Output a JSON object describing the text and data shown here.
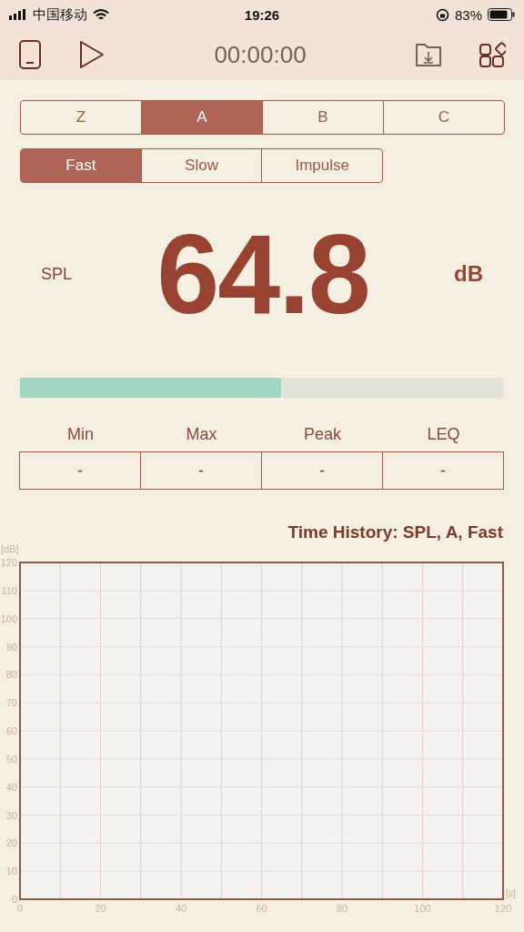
{
  "status_bar": {
    "carrier": "中国移动",
    "time": "19:26",
    "battery": "83%"
  },
  "toolbar": {
    "timer": "00:00:00"
  },
  "weighting_tabs": [
    {
      "label": "Z",
      "selected": false
    },
    {
      "label": "A",
      "selected": true
    },
    {
      "label": "B",
      "selected": false
    },
    {
      "label": "C",
      "selected": false
    }
  ],
  "response_tabs": [
    {
      "label": "Fast",
      "selected": true
    },
    {
      "label": "Slow",
      "selected": false
    },
    {
      "label": "Impulse",
      "selected": false
    }
  ],
  "reading": {
    "label": "SPL",
    "value": "64.8",
    "unit": "dB"
  },
  "meter": {
    "level": 0.54
  },
  "stats": [
    {
      "label": "Min",
      "value": "-"
    },
    {
      "label": "Max",
      "value": "-"
    },
    {
      "label": "Peak",
      "value": "-"
    },
    {
      "label": "LEQ",
      "value": "-"
    }
  ],
  "history": {
    "chart_data": {
      "type": "line",
      "title": "Time History: SPL, A, Fast",
      "ylabel": "[dB]",
      "xlabel": "[s]",
      "grid": true,
      "xlim": [
        0,
        120
      ],
      "ylim": [
        0,
        120
      ],
      "xticks": [
        0,
        20,
        40,
        60,
        80,
        100,
        120
      ],
      "yticks": [
        0,
        10,
        20,
        30,
        40,
        50,
        60,
        70,
        80,
        90,
        100,
        110,
        120
      ]
    }
  }
}
